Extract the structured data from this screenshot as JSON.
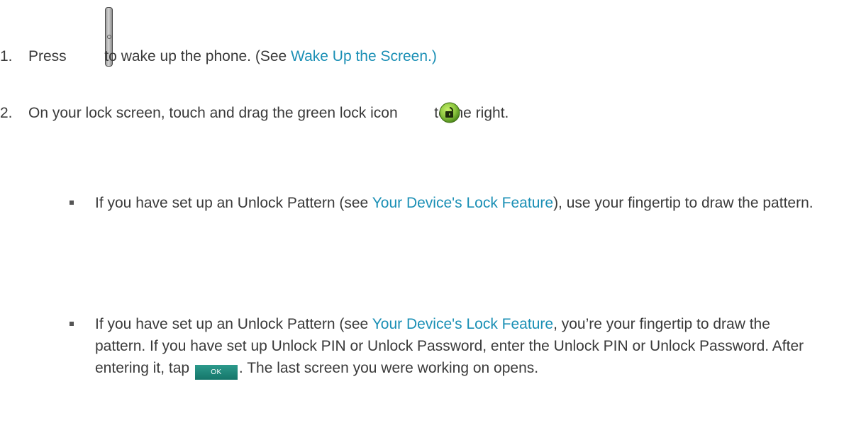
{
  "steps": [
    {
      "number": "1.",
      "text_before_icon": "Press ",
      "icon": "power-key-icon",
      "text_after_icon": " to wake up the phone. (See ",
      "link": "Wake Up the Screen.)"
    },
    {
      "number": "2.",
      "text_before_icon": "On your lock screen, touch and drag the green lock icon ",
      "icon": "green-lock-icon",
      "text_after_icon": " to the right."
    }
  ],
  "bullets": [
    {
      "text_1": "If you have set up an Unlock Pattern (see ",
      "link": "Your Device's Lock Feature",
      "text_2": "), use your fingertip to draw the pattern."
    },
    {
      "text_1": "If you have set up an Unlock Pattern (see ",
      "link": "Your Device's Lock Feature",
      "text_2": ", you’re your fingertip to draw the pattern. If you have set up Unlock PIN or Unlock Password, enter the Unlock PIN or Unlock Password. After entering it, tap ",
      "button_label": "OK",
      "text_3": ". The last screen you were working on opens."
    }
  ],
  "colors": {
    "text": "#3a3a3a",
    "link": "#1a8fb5",
    "lock_icon": "#8cc63f",
    "ok_button": "#15766a"
  }
}
